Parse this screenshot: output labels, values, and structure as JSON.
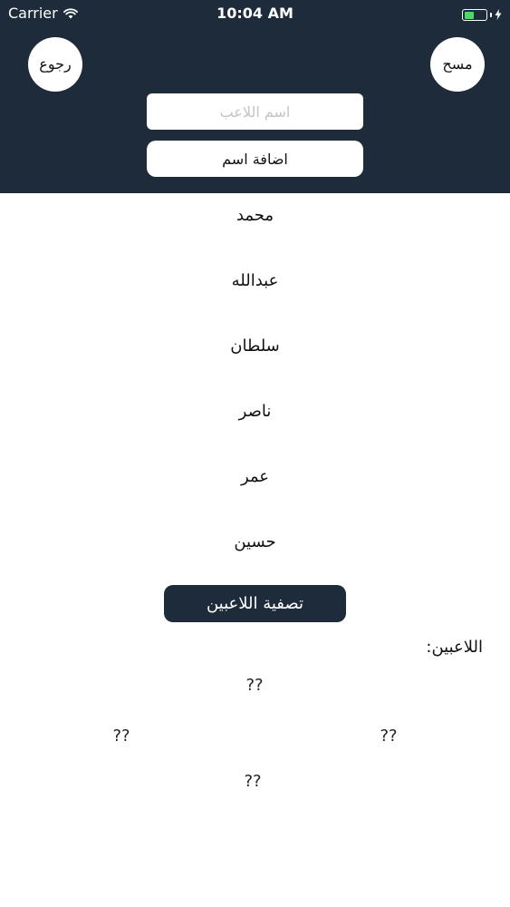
{
  "status_bar": {
    "carrier": "Carrier",
    "time": "10:04 AM"
  },
  "header": {
    "back_label": "رجوع",
    "clear_label": "مسح",
    "name_placeholder": "اسم اللاعب",
    "add_label": "اضافة اسم"
  },
  "names": [
    "محمد",
    "عبدالله",
    "سلطان",
    "ناصر",
    "عمر",
    "حسين"
  ],
  "filter_label": "تصفية اللاعبين",
  "players_label": "اللاعبين:",
  "slots": {
    "top": "??",
    "left": "??",
    "right": "??",
    "bottom": "??"
  },
  "colors": {
    "header_bg": "#1d2b3a",
    "battery": "#4cd964"
  },
  "icons": {
    "wifi": "wifi-icon",
    "battery": "battery-icon",
    "charging": "charging-bolt-icon"
  }
}
